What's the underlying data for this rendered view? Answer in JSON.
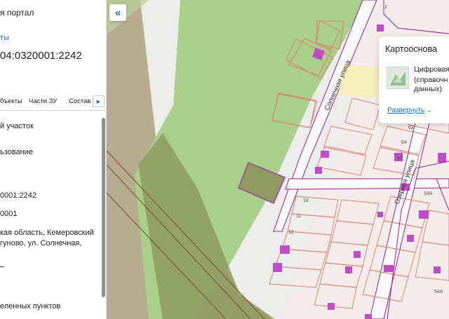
{
  "panel": {
    "portal_title": "я портал",
    "back_link": "ты",
    "cadastral_number": "04:0320001:2242",
    "tabs": [
      {
        "label": "бъекты"
      },
      {
        "label": "Части ЗУ"
      },
      {
        "label": "Состав"
      }
    ],
    "rows": [
      "й участок",
      "ьзование",
      "0001:2242",
      "0001",
      "кая область, Кемеровский",
      "гуново, ул. Солнечная,",
      "еленных пунктов"
    ]
  },
  "map": {
    "collapse_icon": "double-chevron-left-icon",
    "streets": {
      "solnechnaya": "Солнечная улица",
      "ozernaya": "Озерная улица"
    },
    "house_numbers": [
      "2",
      "62",
      "64",
      "60",
      "18",
      "11",
      "12",
      "54А",
      "54А"
    ],
    "colors": {
      "green_zone": "#a9d08e",
      "olive_zone": "#a89a7a",
      "parcel_outline": "#e07b6a",
      "boundary": "#a0208a",
      "building": "#c04cc8",
      "road": "#f7f7f7",
      "selected_parcel": "#9c3aa2"
    }
  },
  "basemap": {
    "title": "Картооснова",
    "name_lines": [
      "Цифровая",
      "(справочн",
      "данных)"
    ],
    "expand_label": "Развернуть",
    "thumb_icon": "basemap-thumbnail-icon"
  }
}
